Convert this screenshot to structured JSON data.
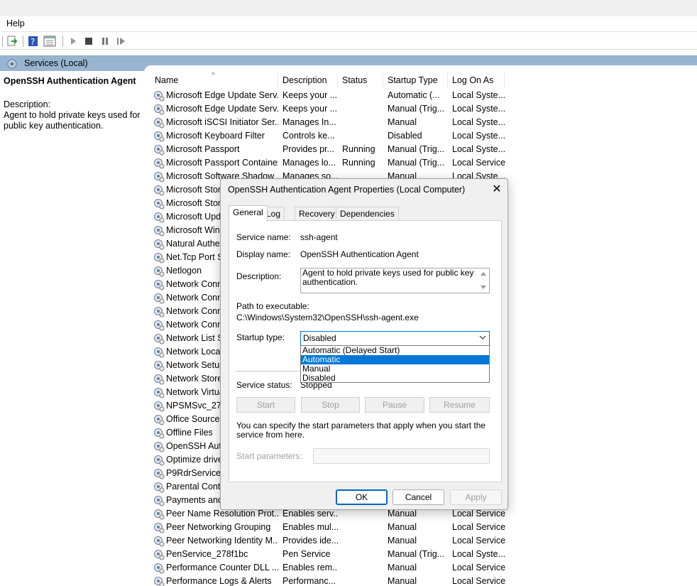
{
  "menubar": {
    "help": "Help"
  },
  "scope": {
    "title": "Services (Local)"
  },
  "leftpane": {
    "service_title": "OpenSSH Authentication Agent",
    "description_label": "Description:",
    "description_text": "Agent to hold private keys used for public key authentication."
  },
  "columns": [
    "Name",
    "Description",
    "Status",
    "Startup Type",
    "Log On As"
  ],
  "rows": [
    {
      "name": "Microsoft Edge Update Serv...",
      "desc": "Keeps your ...",
      "status": "",
      "startup": "Automatic (...",
      "logon": "Local Syste..."
    },
    {
      "name": "Microsoft Edge Update Serv...",
      "desc": "Keeps your ...",
      "status": "",
      "startup": "Manual (Trig...",
      "logon": "Local Syste..."
    },
    {
      "name": "Microsoft iSCSI Initiator Ser...",
      "desc": "Manages In...",
      "status": "",
      "startup": "Manual",
      "logon": "Local Syste..."
    },
    {
      "name": "Microsoft Keyboard Filter",
      "desc": "Controls ke...",
      "status": "",
      "startup": "Disabled",
      "logon": "Local Syste..."
    },
    {
      "name": "Microsoft Passport",
      "desc": "Provides pr...",
      "status": "Running",
      "startup": "Manual (Trig...",
      "logon": "Local Syste..."
    },
    {
      "name": "Microsoft Passport Container",
      "desc": "Manages lo...",
      "status": "Running",
      "startup": "Manual (Trig...",
      "logon": "Local Service"
    },
    {
      "name": "Microsoft Software Shadow ...",
      "desc": "Manages so...",
      "status": "",
      "startup": "Manual",
      "logon": "Local Syste..."
    },
    {
      "name": "Microsoft Stora",
      "desc": "",
      "status": "",
      "startup": "",
      "logon": ""
    },
    {
      "name": "Microsoft Store",
      "desc": "",
      "status": "",
      "startup": "",
      "logon": ""
    },
    {
      "name": "Microsoft Upd",
      "desc": "",
      "status": "",
      "startup": "",
      "logon": ""
    },
    {
      "name": "Microsoft Wind",
      "desc": "",
      "status": "",
      "startup": "",
      "logon": ""
    },
    {
      "name": "Natural Auther",
      "desc": "",
      "status": "",
      "startup": "",
      "logon": ""
    },
    {
      "name": "Net.Tcp Port Sh",
      "desc": "",
      "status": "",
      "startup": "",
      "logon": ""
    },
    {
      "name": "Netlogon",
      "desc": "",
      "status": "",
      "startup": "",
      "logon": ""
    },
    {
      "name": "Network Conn",
      "desc": "",
      "status": "",
      "startup": "",
      "logon": ""
    },
    {
      "name": "Network Conn",
      "desc": "",
      "status": "",
      "startup": "",
      "logon": ""
    },
    {
      "name": "Network Conn",
      "desc": "",
      "status": "",
      "startup": "",
      "logon": ""
    },
    {
      "name": "Network Conn",
      "desc": "",
      "status": "",
      "startup": "",
      "logon": ""
    },
    {
      "name": "Network List S",
      "desc": "",
      "status": "",
      "startup": "",
      "logon": ""
    },
    {
      "name": "Network Locat",
      "desc": "",
      "status": "",
      "startup": "",
      "logon": ""
    },
    {
      "name": "Network Setup",
      "desc": "",
      "status": "",
      "startup": "",
      "logon": ""
    },
    {
      "name": "Network Store",
      "desc": "",
      "status": "",
      "startup": "",
      "logon": ""
    },
    {
      "name": "Network Virtua",
      "desc": "",
      "status": "",
      "startup": "",
      "logon": ""
    },
    {
      "name": "NPSMSvc_278f",
      "desc": "",
      "status": "",
      "startup": "",
      "logon": ""
    },
    {
      "name": "Office  Source",
      "desc": "",
      "status": "",
      "startup": "",
      "logon": ""
    },
    {
      "name": "Offline Files",
      "desc": "",
      "status": "",
      "startup": "",
      "logon": ""
    },
    {
      "name": "OpenSSH Auth",
      "desc": "",
      "status": "",
      "startup": "",
      "logon": ""
    },
    {
      "name": "Optimize drive",
      "desc": "",
      "status": "",
      "startup": "",
      "logon": ""
    },
    {
      "name": "P9RdrService_2",
      "desc": "",
      "status": "",
      "startup": "",
      "logon": ""
    },
    {
      "name": "Parental Contr",
      "desc": "",
      "status": "",
      "startup": "",
      "logon": ""
    },
    {
      "name": "Payments and",
      "desc": "",
      "status": "",
      "startup": "",
      "logon": ""
    },
    {
      "name": "Peer Name Resolution Prot...",
      "desc": "Enables serv...",
      "status": "",
      "startup": "Manual",
      "logon": "Local Service"
    },
    {
      "name": "Peer Networking Grouping",
      "desc": "Enables mul...",
      "status": "",
      "startup": "Manual",
      "logon": "Local Service"
    },
    {
      "name": "Peer Networking Identity M...",
      "desc": "Provides ide...",
      "status": "",
      "startup": "Manual",
      "logon": "Local Service"
    },
    {
      "name": "PenService_278f1bc",
      "desc": "Pen Service",
      "status": "",
      "startup": "Manual (Trig...",
      "logon": "Local Syste..."
    },
    {
      "name": "Performance Counter DLL ...",
      "desc": "Enables rem...",
      "status": "",
      "startup": "Manual",
      "logon": "Local Service"
    },
    {
      "name": "Performance Logs & Alerts",
      "desc": "Performanc...",
      "status": "",
      "startup": "Manual",
      "logon": "Local Service"
    }
  ],
  "dialog": {
    "title": "OpenSSH Authentication Agent Properties (Local Computer)",
    "close": "✕",
    "tabs": [
      "General",
      "Log On",
      "Recovery",
      "Dependencies"
    ],
    "service_name_label": "Service name:",
    "service_name_value": "ssh-agent",
    "display_name_label": "Display name:",
    "display_name_value": "OpenSSH Authentication Agent",
    "description_label": "Description:",
    "description_value": "Agent to hold private keys used for public key authentication.",
    "path_label": "Path to executable:",
    "path_value": "C:\\Windows\\System32\\OpenSSH\\ssh-agent.exe",
    "startup_type_label": "Startup type:",
    "startup_type_value": "Disabled",
    "startup_options": [
      "Automatic (Delayed Start)",
      "Automatic",
      "Manual",
      "Disabled"
    ],
    "highlighted_option": "Automatic",
    "service_status_label": "Service status:",
    "service_status_value": "Stopped",
    "buttons": {
      "start": "Start",
      "stop": "Stop",
      "pause": "Pause",
      "resume": "Resume"
    },
    "hint": "You can specify the start parameters that apply when you start the service from here.",
    "start_params_label": "Start parameters:",
    "start_params_value": "",
    "ok": "OK",
    "cancel": "Cancel",
    "apply": "Apply"
  },
  "colors": {
    "scope_bar": "#99b4d1",
    "highlight": "#0078d7",
    "accent_border": "#0067c0"
  }
}
